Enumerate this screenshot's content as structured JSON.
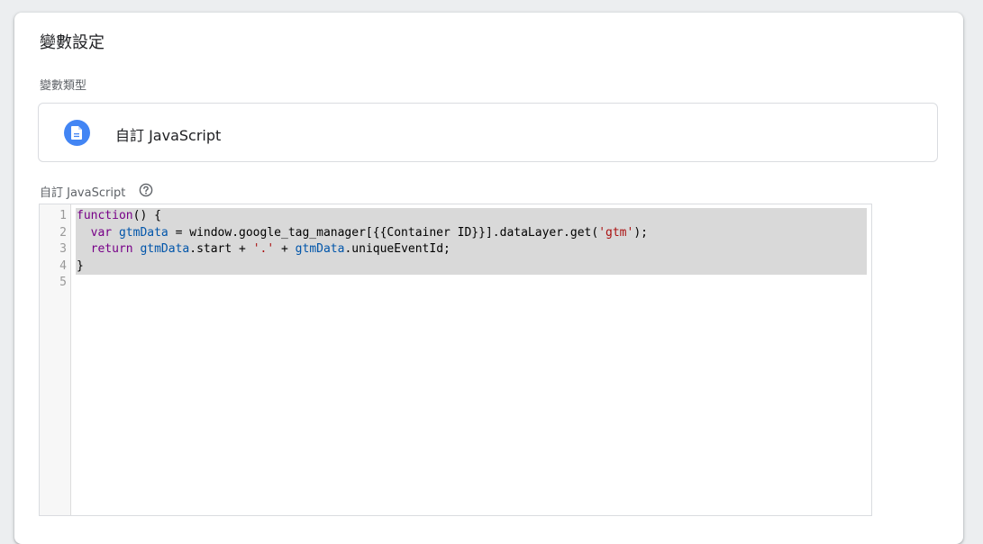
{
  "card": {
    "title": "變數設定"
  },
  "variable_type": {
    "label": "變數類型",
    "name": "自訂 JavaScript",
    "icon": "document-icon",
    "icon_color": "#4285f4"
  },
  "code_editor": {
    "label": "自訂 JavaScript",
    "help_icon": "help-circle-icon",
    "line_numbers": [
      "1",
      "2",
      "3",
      "4",
      "5"
    ],
    "lines": [
      [
        {
          "t": "function",
          "c": "kw"
        },
        {
          "t": "() {",
          "c": "plain"
        }
      ],
      [
        {
          "t": "  ",
          "c": "plain"
        },
        {
          "t": "var",
          "c": "kw"
        },
        {
          "t": " ",
          "c": "plain"
        },
        {
          "t": "gtmData",
          "c": "var"
        },
        {
          "t": " = window.google_tag_manager[{{Container ID}}].dataLayer.get(",
          "c": "plain"
        },
        {
          "t": "'gtm'",
          "c": "str"
        },
        {
          "t": ");",
          "c": "plain"
        }
      ],
      [
        {
          "t": "  ",
          "c": "plain"
        },
        {
          "t": "return",
          "c": "kw"
        },
        {
          "t": " ",
          "c": "plain"
        },
        {
          "t": "gtmData",
          "c": "var"
        },
        {
          "t": ".start + ",
          "c": "plain"
        },
        {
          "t": "'.'",
          "c": "str"
        },
        {
          "t": " + ",
          "c": "plain"
        },
        {
          "t": "gtmData",
          "c": "var"
        },
        {
          "t": ".uniqueEventId;",
          "c": "plain"
        }
      ],
      [
        {
          "t": "}",
          "c": "plain"
        }
      ],
      []
    ],
    "selected_lines": [
      0,
      1,
      2,
      3
    ],
    "colors": {
      "keyword": "#770088",
      "variable": "#0055aa",
      "string": "#aa1111",
      "selection": "#d9d9d9"
    }
  }
}
